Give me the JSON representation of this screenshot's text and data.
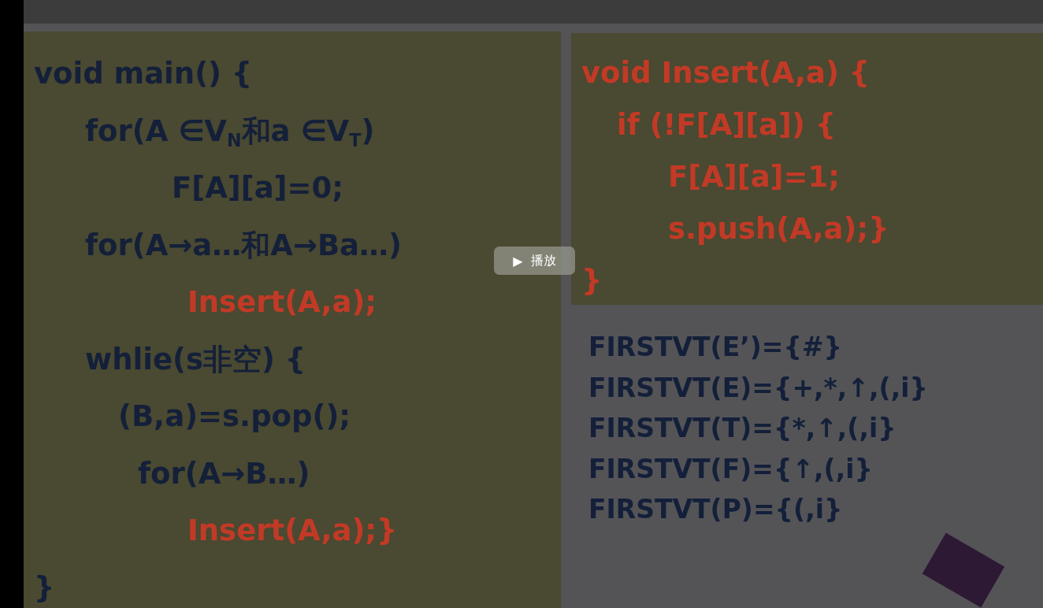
{
  "player": {
    "play_button": {
      "icon": "▶",
      "label": "播放"
    }
  },
  "slide": {
    "main_code": [
      {
        "text": "void main() {",
        "kind": "plain"
      },
      {
        "text": "for(A ∈V$_{N}$和a ∈V$_{T}$)",
        "kind": "plain"
      },
      {
        "text": "F[A][a]=0;",
        "kind": "plain"
      },
      {
        "text": "for(A→a…和A→Ba…)",
        "kind": "plain"
      },
      {
        "text": "Insert(A,a);",
        "kind": "call"
      },
      {
        "text": "whlie(s非空) {",
        "kind": "plain"
      },
      {
        "text": "(B,a)=s.pop();",
        "kind": "plain"
      },
      {
        "text": "for(A→B…)",
        "kind": "plain"
      },
      {
        "text": "Insert(A,a);}",
        "kind": "call"
      },
      {
        "text": "}",
        "kind": "plain"
      }
    ],
    "insert_code": [
      "void Insert(A,a) {",
      "if (!F[A][a]) {",
      "F[A][a]=1;",
      "s.push(A,a);}",
      "}"
    ],
    "firstvt": [
      "FIRSTVT(E’)={#}",
      "FIRSTVT(E)={+,*,↑,(,i}",
      "FIRSTVT(T)={*,↑,(,i}",
      "FIRSTVT(F)={↑,(,i}",
      "FIRSTVT(P)={(,i}"
    ]
  }
}
